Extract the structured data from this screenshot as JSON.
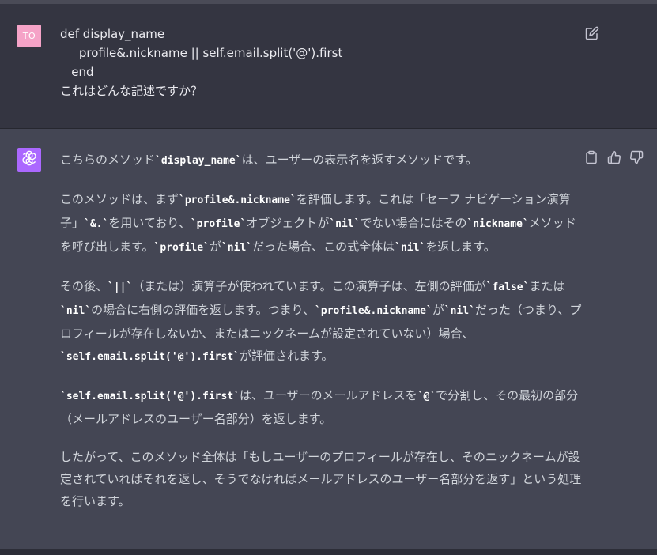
{
  "user_message": {
    "avatar_initials": "TO",
    "lines": [
      "def display_name",
      "     profile&.nickname || self.email.split('@').first",
      "   end",
      "これはどんな記述ですか？"
    ]
  },
  "assistant_message": {
    "p1": {
      "t0": "こちらのメソッド",
      "c0": "`display_name`",
      "t1": "は、ユーザーの表示名を返すメソッドです。"
    },
    "p2": {
      "t0": "このメソッドは、まず",
      "c0": "`profile&.nickname`",
      "t1": "を評価します。これは「セーフ ナビゲーション演算子」",
      "c1": "`&.`",
      "t2": "を用いており、",
      "c2": "`profile`",
      "t3": "オブジェクトが",
      "c3": "`nil`",
      "t4": "でない場合にはその",
      "c4": "`nickname`",
      "t5": "メソッドを呼び出します。",
      "c5": "`profile`",
      "t6": "が",
      "c6": "`nil`",
      "t7": "だった場合、この式全体は",
      "c7": "`nil`",
      "t8": "を返します。"
    },
    "p3": {
      "t0": "その後、",
      "c0": "`||`",
      "t1": "（または）演算子が使われています。この演算子は、左側の評価が",
      "c1": "`false`",
      "t2": "または",
      "c2": "`nil`",
      "t3": "の場合に右側の評価を返します。つまり、",
      "c3": "`profile&.nickname`",
      "t4": "が",
      "c4": "`nil`",
      "t5": "だった（つまり、プロフィールが存在しないか、またはニックネームが設定されていない）場合、",
      "c5": "`self.email.split('@').first`",
      "t6": "が評価されます。"
    },
    "p4": {
      "c0": "`self.email.split('@').first`",
      "t0": "は、ユーザーのメールアドレスを",
      "c1": "`@`",
      "t1": "で分割し、その最初の部分（メールアドレスのユーザー名部分）を返します。"
    },
    "p5": {
      "t0": "したがって、このメソッド全体は「もしユーザーのプロフィールが存在し、そのニックネームが設定されていればそれを返し、そうでなければメールアドレスのユーザー名部分を返す」という処理を行います。"
    }
  },
  "icons": {
    "edit": "pencil-square-icon",
    "copy": "clipboard-icon",
    "like": "thumbs-up-icon",
    "dislike": "thumbs-down-icon",
    "bot_avatar": "openai-logo-icon"
  },
  "colors": {
    "background": "#343541",
    "assistant_background": "#444654",
    "user_avatar": "#f5a3c7",
    "bot_avatar": "#ab68ff"
  }
}
